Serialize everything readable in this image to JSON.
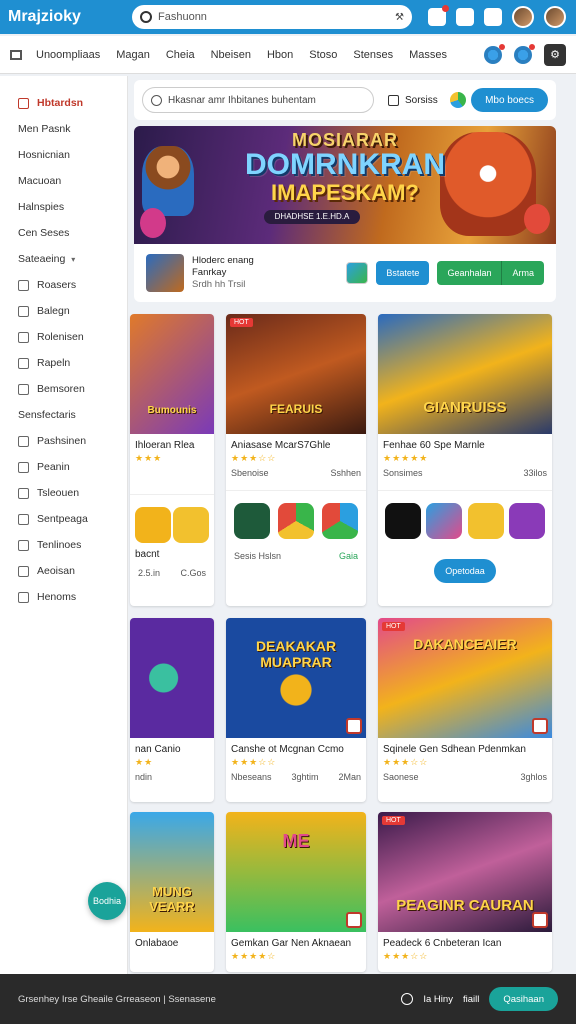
{
  "topbar": {
    "logo": "Mrajzioky",
    "search_placeholder": "Fashuonn",
    "mic": "⚒"
  },
  "navbar": {
    "items": [
      "Unoompliaas",
      "Magan",
      "Cheia",
      "Nbeisen",
      "Hbon",
      "Stoso",
      "Stenses",
      "Masses"
    ]
  },
  "sidebar": {
    "items": [
      {
        "label": "Hbtardsn",
        "active": true
      },
      {
        "label": "Men Pasnk"
      },
      {
        "label": "Hosnicnian"
      },
      {
        "label": "Macuoan"
      },
      {
        "label": "Halnspies"
      },
      {
        "label": "Cen Seses"
      },
      {
        "label": "Sateaeing",
        "caret": "▾"
      },
      {
        "label": "Roasers"
      },
      {
        "label": "Balegn"
      },
      {
        "label": "Rolenisen"
      },
      {
        "label": "Rapeln"
      },
      {
        "label": "Bemsoren"
      },
      {
        "label": "Sensfectaris"
      },
      {
        "label": "Pashsinen"
      },
      {
        "label": "Peanin"
      },
      {
        "label": "Tsleouen"
      },
      {
        "label": "Sentpeaga"
      },
      {
        "label": "Tenlinoes"
      },
      {
        "label": "Aeoisan"
      },
      {
        "label": "Henoms"
      }
    ]
  },
  "main": {
    "search_placeholder": "Hkasnar amr Ihbitanes buhentam",
    "sort_label": "Sorsiss",
    "top_button": "Mbo boecs",
    "banner": {
      "line1": "MOSIARAR",
      "line2": "DOMRNKRAN",
      "line3": "IMAPESKAM?",
      "tagline": "DHADHSE 1.E.HD.A",
      "info_title": "Hloderc enang",
      "info_sub": "Fanrkay",
      "info_meta": "Srdh hh  Trsil",
      "btn_primary": "Bstatete",
      "btn_green_a": "Geanhalan",
      "btn_green_b": "Arma"
    }
  },
  "cards": {
    "c1": {
      "art": "Bumounis",
      "title": "Ihloeran Rlea",
      "stars": "★★★",
      "apps_foot_left": "bacnt",
      "foot_left": "2.5.in",
      "foot_right": "C.Gos"
    },
    "c2": {
      "art": "FEARUIS",
      "hot": "HOT",
      "title": "Aniasase McarS7Ghle",
      "stars": "★★★☆☆",
      "meta_left": "Sbenoise",
      "meta_right": "Sshhen",
      "foot_left": "Sesis Hslsn",
      "foot_right": "Gaia"
    },
    "c3": {
      "art": "GIANRUISS",
      "title": "Fenhae 60 Spe Marnle",
      "stars": "★★★★★",
      "meta_left": "Sonsimes",
      "meta_right": "33ilos",
      "btn": "Opetodaa"
    },
    "c4": {
      "art": "",
      "title": "nan Canio",
      "stars": "★★",
      "meta_left": "ndin",
      "meta_right": ""
    },
    "c5": {
      "art": "DEAKAKAR MUAPRAR",
      "title": "Canshe ot Mcgnan Ccmo",
      "stars": "★★★☆☆",
      "meta_left": "Nbeseans",
      "meta_right": "3ghtim",
      "meta_far": "2Man"
    },
    "c6": {
      "art": "DAKANCEAIER",
      "hot": "HOT",
      "title": "Sqinele Gen Sdhean Pdenmkan",
      "stars": "★★★☆☆",
      "meta_left": "Saonese",
      "meta_right": "3ghlos"
    },
    "c7": {
      "art": "MUNG VEARR",
      "title": "Onlabaoe"
    },
    "c8": {
      "art": "ME",
      "title": "Gemkan Gar Nen Aknaean",
      "stars": "★★★★☆"
    },
    "c9": {
      "art": "PEAGINR CAURAN",
      "hot": "HOT",
      "title": "Peadeck 6 Cnbeteran Ican",
      "stars": "★★★☆☆"
    }
  },
  "fab": {
    "label": "Bodhia"
  },
  "bottombar": {
    "left": "Grsenhey Irse Gheaile   Grreaseon | Ssenasene",
    "mid": "Ia Hiny",
    "mid2": "fiaill",
    "btn": "Qasihaan"
  },
  "colors": {
    "primary": "#1f8fd1",
    "green": "#2aa65a",
    "teal": "#1aa39a",
    "active": "#c0392b"
  }
}
